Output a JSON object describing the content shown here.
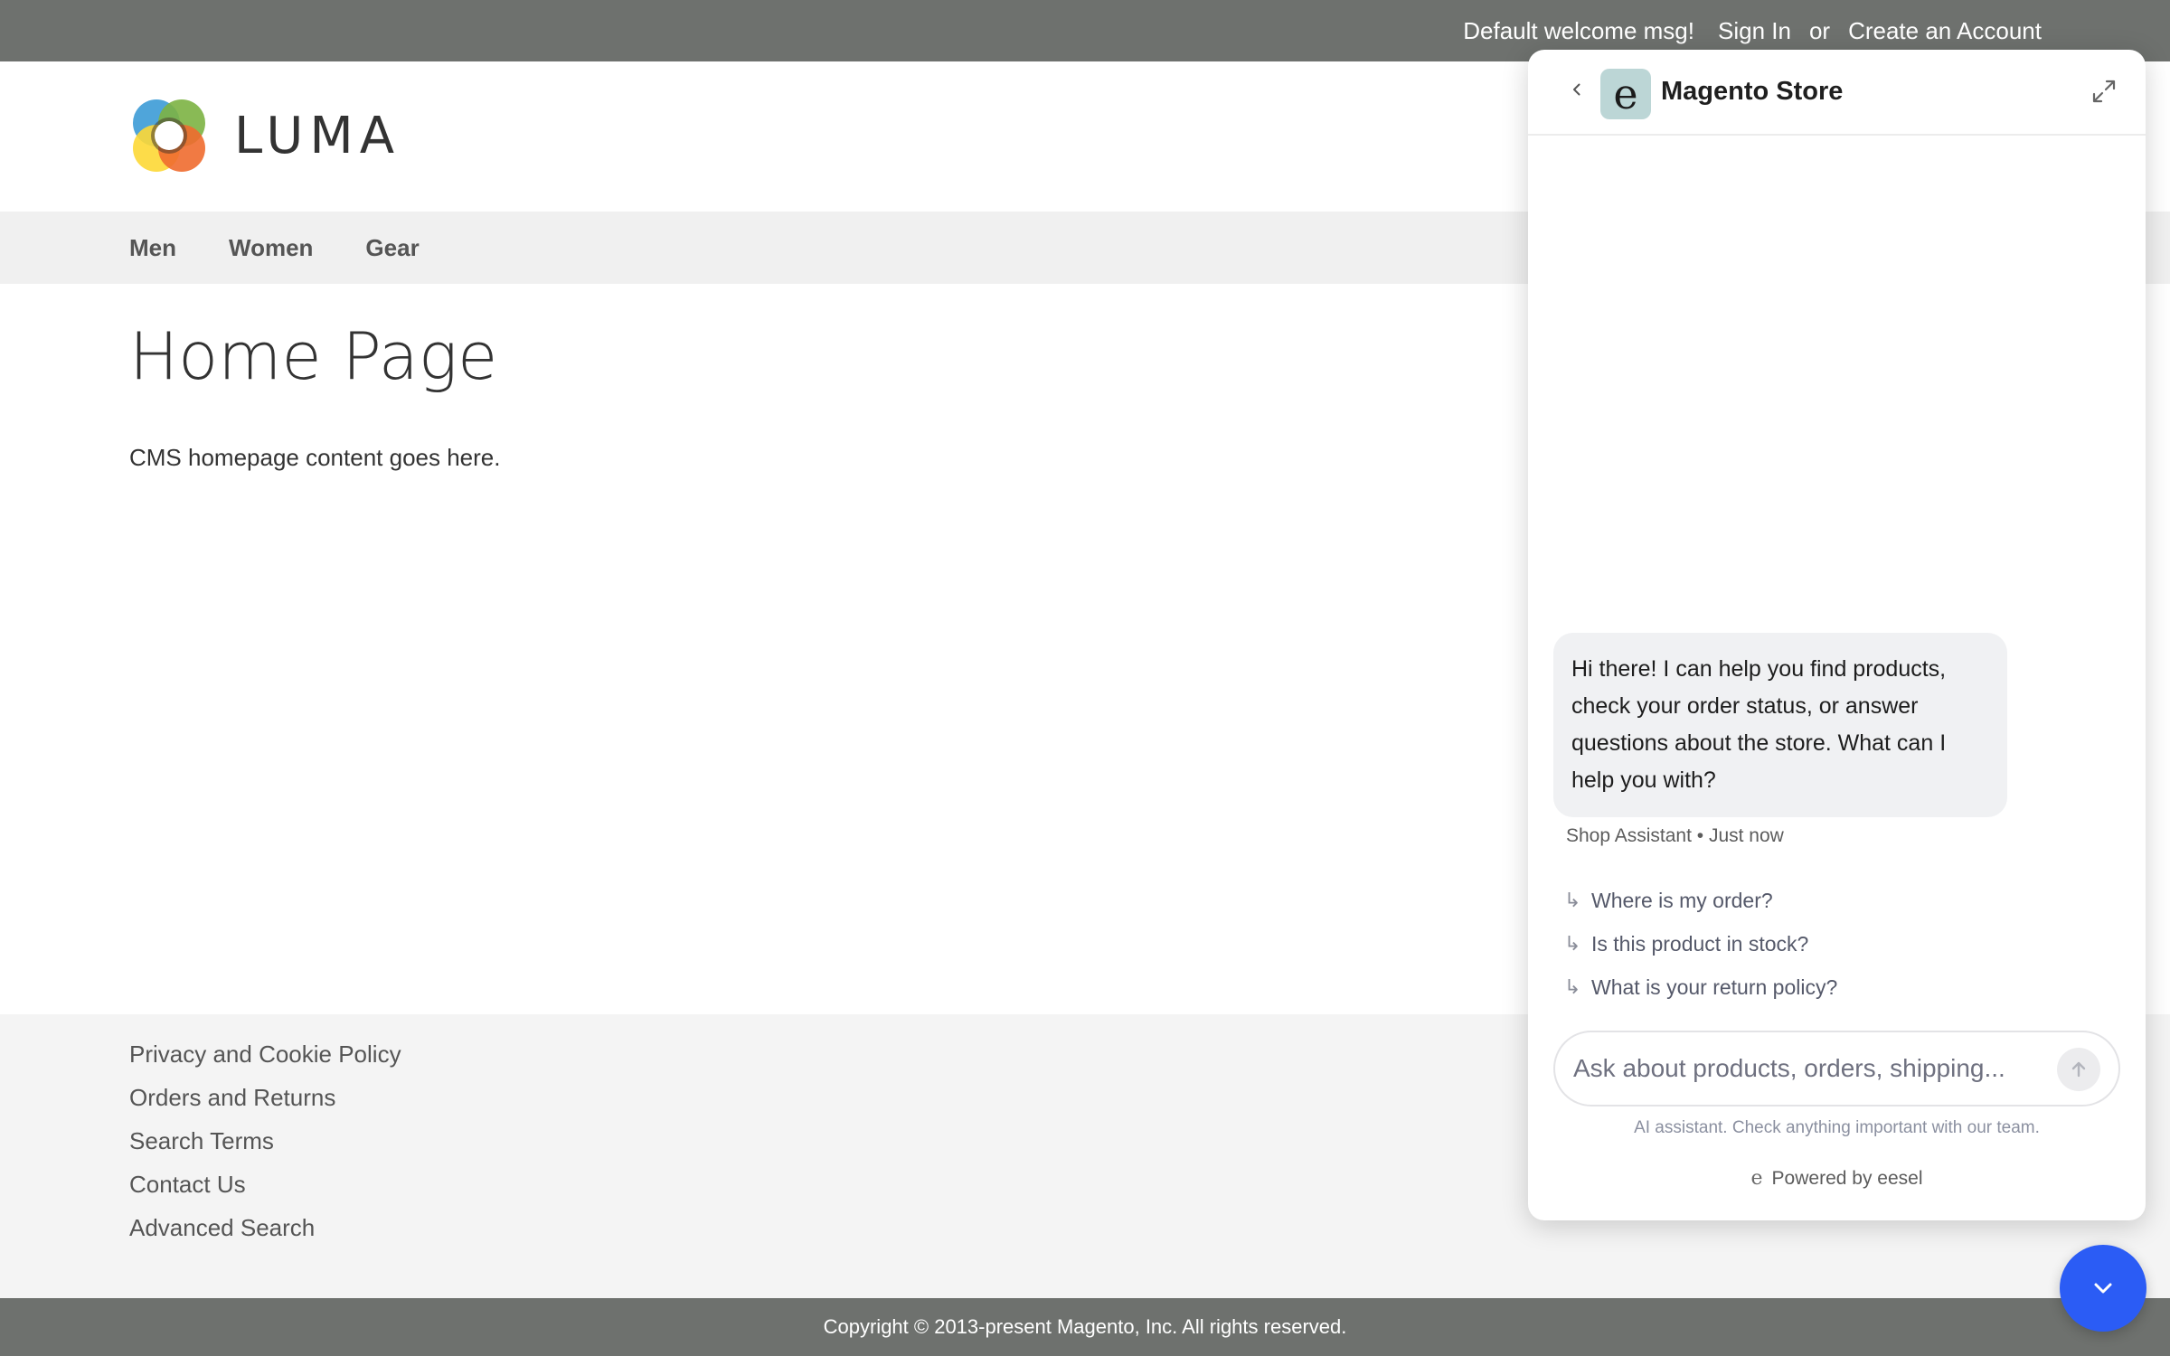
{
  "topbar": {
    "welcome": "Default welcome msg!",
    "sign_in": "Sign In",
    "or": "or",
    "create_account": "Create an Account"
  },
  "header": {
    "logo_text": "LUMA"
  },
  "nav": {
    "items": [
      "Men",
      "Women",
      "Gear"
    ]
  },
  "main": {
    "title": "Home Page",
    "body": "CMS homepage content goes here."
  },
  "footer": {
    "links": [
      "Privacy and Cookie Policy",
      "Orders and Returns",
      "Search Terms",
      "Contact Us",
      "Advanced Search"
    ],
    "copyright": "Copyright © 2013-present Magento, Inc. All rights reserved."
  },
  "chat": {
    "title": "Magento Store",
    "avatar_letter": "e",
    "message": "Hi there! I can help you find products, check your order status, or answer questions about the store. What can I help you with?",
    "meta": "Shop Assistant • Just now",
    "suggestions": [
      "Where is my order?",
      "Is this product in stock?",
      "What is your return policy?"
    ],
    "suggestion_arrow": "↳",
    "input_placeholder": "Ask about products, orders, shipping...",
    "input_value": "",
    "disclaimer": "AI assistant. Check anything important with our team.",
    "powered_mark": "e",
    "powered_by": "Powered by eesel",
    "icons": {
      "back": "chevron-left-icon",
      "expand": "expand-icon",
      "send": "arrow-up-icon",
      "launcher": "chevron-down-icon"
    }
  },
  "colors": {
    "topbar_bg": "#6e716e",
    "nav_bg": "#f0f0f0",
    "footer_bg": "#f4f4f4",
    "chat_avatar_bg": "#bcd6d6",
    "launcher_bg": "#2b5cf5"
  }
}
